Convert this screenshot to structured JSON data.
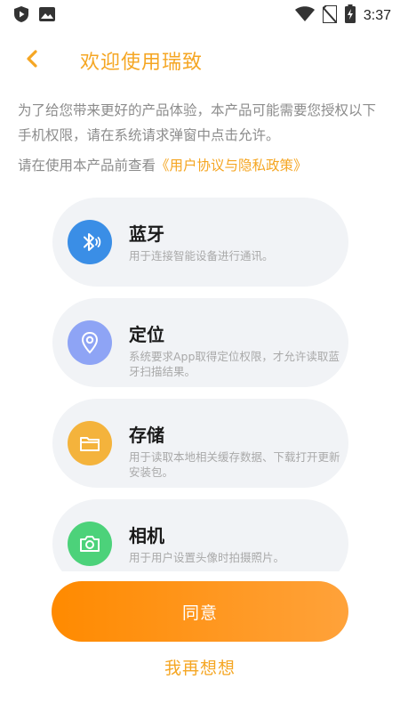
{
  "status_bar": {
    "time": "3:37",
    "left_icons": [
      "shield-play-icon",
      "image-icon"
    ],
    "right_icons": [
      "wifi-icon",
      "no-sim-icon",
      "battery-charging-icon"
    ]
  },
  "header": {
    "back_icon": "chevron-left-icon",
    "title": "欢迎使用瑞致"
  },
  "intro": {
    "text": "为了给您带来更好的产品体验，本产品可能需要您授权以下手机权限，请在系统请求弹窗中点击允许。",
    "policy_prefix": "请在使用本产品前查看",
    "policy_link": "《用户协议与隐私政策》"
  },
  "permissions": [
    {
      "title": "蓝牙",
      "desc": "用于连接智能设备进行通讯。",
      "icon": "bluetooth-icon",
      "color": "#3a8ee6"
    },
    {
      "title": "定位",
      "desc": "系统要求App取得定位权限，才允许读取蓝牙扫描结果。",
      "icon": "location-icon",
      "color": "#8ea4f5"
    },
    {
      "title": "存储",
      "desc": "用于读取本地相关缓存数据、下载打开更新安装包。",
      "icon": "folder-icon",
      "color": "#f4b33c"
    },
    {
      "title": "相机",
      "desc": "用于用户设置头像时拍摄照片。",
      "icon": "camera-icon",
      "color": "#4cd27a"
    }
  ],
  "actions": {
    "agree_label": "同意",
    "think_label": "我再想想"
  },
  "colors": {
    "accent": "#f5a623",
    "button_gradient_start": "#ff8a00",
    "button_gradient_end": "#ffa23a",
    "card_bg": "#f1f3f6"
  }
}
